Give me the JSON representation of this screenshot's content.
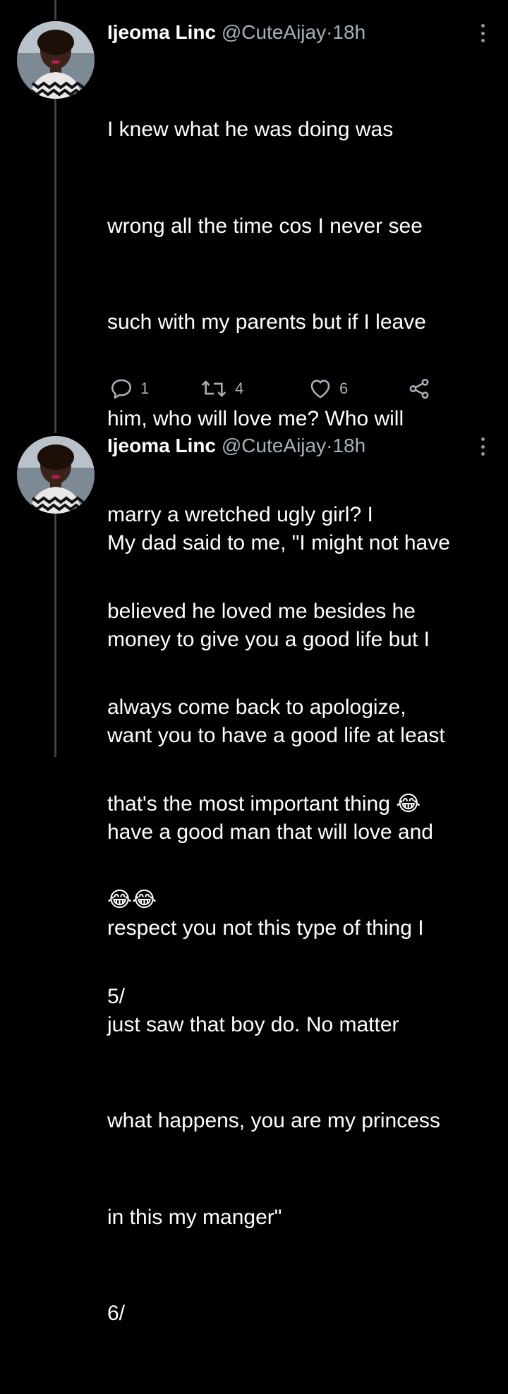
{
  "tweets": [
    {
      "name": "Ijeoma Linc",
      "handle": "@CuteAijay",
      "dot": "·",
      "time": "18h",
      "lines": [
        "I knew what he was doing was",
        "wrong all the time cos I never see",
        "such with my parents but if I leave",
        "him, who will love me? Who will",
        "marry a wretched ugly girl? I",
        "believed he loved me besides he",
        "always come back to apologize,",
        "that's the most important thing 😂",
        "😂😂",
        "5/"
      ],
      "replies": "1",
      "retweets": "4",
      "likes": "6"
    },
    {
      "name": "Ijeoma Linc",
      "handle": "@CuteAijay",
      "dot": "·",
      "time": "18h",
      "lines": [
        "My dad said to me, \"I might not have",
        "money to give you a good life but I",
        "want you to have a good life at least",
        "have a good man that will love and",
        "respect you not this type of thing I",
        "just saw that boy do. No matter",
        "what happens, you are my princess",
        "in this my manger\"",
        "6/"
      ]
    }
  ],
  "colors": {
    "background": "#000000",
    "text": "#ffffff",
    "muted": "#a7b0b8",
    "thread_line": "#3d4247"
  },
  "icons": [
    "reply-icon",
    "retweet-icon",
    "like-icon",
    "share-icon",
    "more-icon"
  ]
}
